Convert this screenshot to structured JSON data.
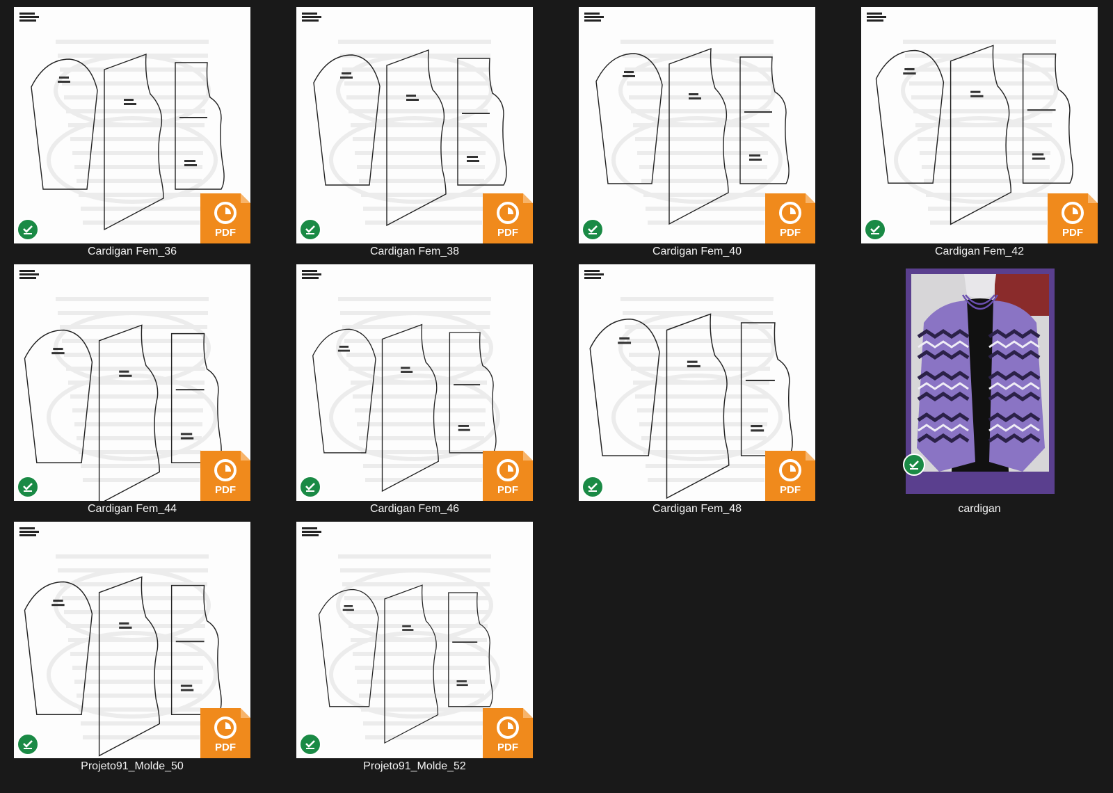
{
  "colors": {
    "background": "#191919",
    "pdf_badge": "#f08a1c",
    "sync_check": "#1a8a45",
    "photo_frame": "#5a3f8e"
  },
  "badge": {
    "text": "PDF"
  },
  "files": [
    {
      "name": "Cardigan Fem_36",
      "type": "pdf",
      "icon": "pdf-file-icon",
      "status": "synced"
    },
    {
      "name": "Cardigan Fem_38",
      "type": "pdf",
      "icon": "pdf-file-icon",
      "status": "synced"
    },
    {
      "name": "Cardigan Fem_40",
      "type": "pdf",
      "icon": "pdf-file-icon",
      "status": "synced"
    },
    {
      "name": "Cardigan Fem_42",
      "type": "pdf",
      "icon": "pdf-file-icon",
      "status": "synced"
    },
    {
      "name": "Cardigan Fem_44",
      "type": "pdf",
      "icon": "pdf-file-icon",
      "status": "synced"
    },
    {
      "name": "Cardigan Fem_46",
      "type": "pdf",
      "icon": "pdf-file-icon",
      "status": "synced"
    },
    {
      "name": "Cardigan Fem_48",
      "type": "pdf",
      "icon": "pdf-file-icon",
      "status": "synced"
    },
    {
      "name": "cardigan",
      "type": "image",
      "icon": "image-file-icon",
      "status": "synced"
    },
    {
      "name": "Projeto91_Molde_50",
      "type": "pdf",
      "icon": "pdf-file-icon",
      "status": "synced"
    },
    {
      "name": "Projeto91_Molde_52",
      "type": "pdf",
      "icon": "pdf-file-icon",
      "status": "synced"
    }
  ]
}
